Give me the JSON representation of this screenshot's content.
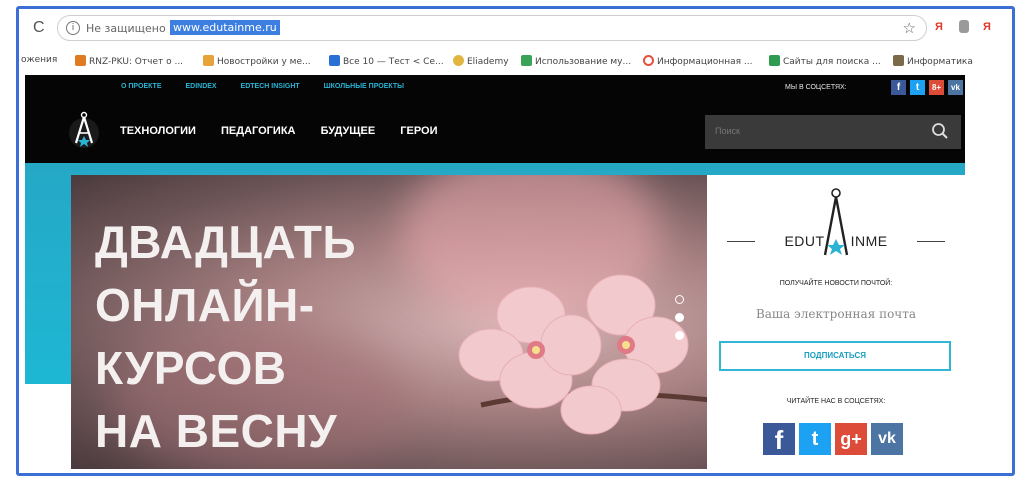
{
  "browser": {
    "reload_glyph": "C",
    "info_glyph": "i",
    "secure_text": "Не защищено",
    "url": "www.edutainme.ru",
    "star_glyph": "☆",
    "ext1": "Я",
    "ext2": "Я"
  },
  "bookmarks": [
    {
      "label": "ожения",
      "icon": "none",
      "color": "#ffffff"
    },
    {
      "label": "RNZ-PKU: Отчет о ...",
      "icon": "bookmark-icon",
      "color": "#e07b22"
    },
    {
      "label": "Новостройки у ме...",
      "icon": "bookmark-icon",
      "color": "#e8a23a"
    },
    {
      "label": "Все 10 — Тест < Се...",
      "icon": "bookmark-icon",
      "color": "#2a6fd6"
    },
    {
      "label": "Eliademy",
      "icon": "bookmark-icon",
      "color": "#e0b640"
    },
    {
      "label": "Использование му...",
      "icon": "drive-icon",
      "color": "#3aa357"
    },
    {
      "label": "Информационная ...",
      "icon": "bookmark-icon",
      "color": "#e8503a"
    },
    {
      "label": "Сайты для поиска ...",
      "icon": "sheets-icon",
      "color": "#2e9b50"
    },
    {
      "label": "Информатика",
      "icon": "bookmark-icon",
      "color": "#7a6a4a"
    }
  ],
  "site": {
    "topnav": [
      "О ПРОЕКТЕ",
      "EDINDEX",
      "EDTECH INSIGHT",
      "ШКОЛЬНЫЕ ПРОЕКТЫ"
    ],
    "social_label": "МЫ В СОЦСЕТЯХ:",
    "social_top": [
      {
        "label": "f",
        "color": "#3b5998"
      },
      {
        "label": "t",
        "color": "#1da1f2"
      },
      {
        "label": "8+",
        "color": "#dd4b39"
      },
      {
        "label": "vk",
        "color": "#4c75a3"
      }
    ],
    "mainnav": [
      "ТЕХНОЛОГИИ",
      "ПЕДАГОГИКА",
      "БУДУЩЕЕ",
      "ГЕРОИ"
    ],
    "search_placeholder": "Поиск"
  },
  "hero": {
    "title_lines": [
      "ДВАДЦАТЬ",
      "ОНЛАЙН-",
      "КУРСОВ",
      "НА ВЕСНУ"
    ]
  },
  "sidebar": {
    "brand_left": "EDUT",
    "brand_right": "INME",
    "news_label": "ПОЛУЧАЙТЕ НОВОСТИ ПОЧТОЙ:",
    "email_placeholder": "Ваша электронная почта",
    "subscribe_label": "ПОДПИСАТЬСЯ",
    "read_label": "ЧИТАЙТЕ НАС В СОЦСЕТЯХ:",
    "social": [
      {
        "label": "f",
        "color": "#3b5998"
      },
      {
        "label": "t",
        "color": "#1da1f2"
      },
      {
        "label": "g+",
        "color": "#dd4b39"
      },
      {
        "label": "vk",
        "color": "#4c75a3"
      }
    ]
  },
  "colors": {
    "accent": "#2bb3d4",
    "frame": "#3b6fd6"
  }
}
